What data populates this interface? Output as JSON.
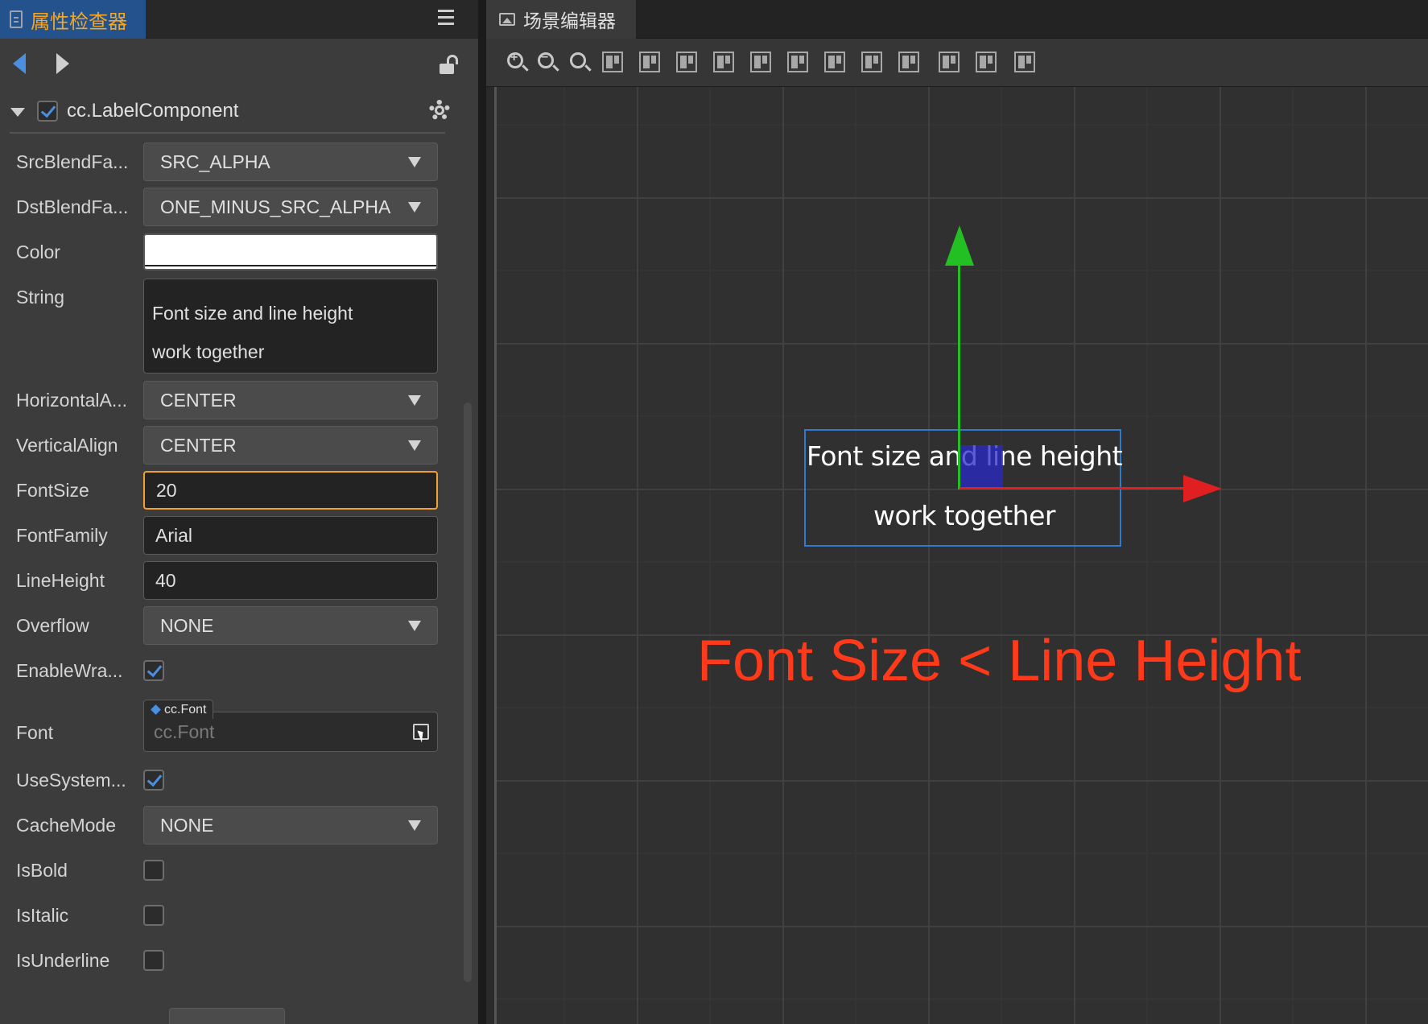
{
  "inspector": {
    "tab_title": "属性检查器",
    "component": {
      "name": "cc.LabelComponent",
      "enabled": true
    },
    "properties": {
      "src_blend": {
        "label": "SrcBlendFa...",
        "value": "SRC_ALPHA"
      },
      "dst_blend": {
        "label": "DstBlendFa...",
        "value": "ONE_MINUS_SRC_ALPHA"
      },
      "color": {
        "label": "Color",
        "value": "#FFFFFF"
      },
      "string": {
        "label": "String",
        "line1": "Font size and line height",
        "line2": "work together"
      },
      "horizontal_align": {
        "label": "HorizontalA...",
        "value": "CENTER"
      },
      "vertical_align": {
        "label": "VerticalAlign",
        "value": "CENTER"
      },
      "font_size": {
        "label": "FontSize",
        "value": "20"
      },
      "font_family": {
        "label": "FontFamily",
        "value": "Arial"
      },
      "line_height": {
        "label": "LineHeight",
        "value": "40"
      },
      "overflow": {
        "label": "Overflow",
        "value": "NONE"
      },
      "enable_wrap": {
        "label": "EnableWra...",
        "checked": true
      },
      "font": {
        "label": "Font",
        "type_tag": "cc.Font",
        "placeholder": "cc.Font"
      },
      "use_system_font": {
        "label": "UseSystem...",
        "checked": true
      },
      "cache_mode": {
        "label": "CacheMode",
        "value": "NONE"
      },
      "is_bold": {
        "label": "IsBold",
        "checked": false
      },
      "is_italic": {
        "label": "IsItalic",
        "checked": false
      },
      "is_underline": {
        "label": "IsUnderline",
        "checked": false
      }
    }
  },
  "scene": {
    "tab_title": "场景编辑器",
    "label_line1": "Font size and line height",
    "label_line2": "work together",
    "annotation": "Font Size < Line Height",
    "colors": {
      "x_axis": "#e02020",
      "y_axis": "#22c022",
      "selection": "#2f7ccf",
      "annotation": "#ff3a1a"
    }
  }
}
